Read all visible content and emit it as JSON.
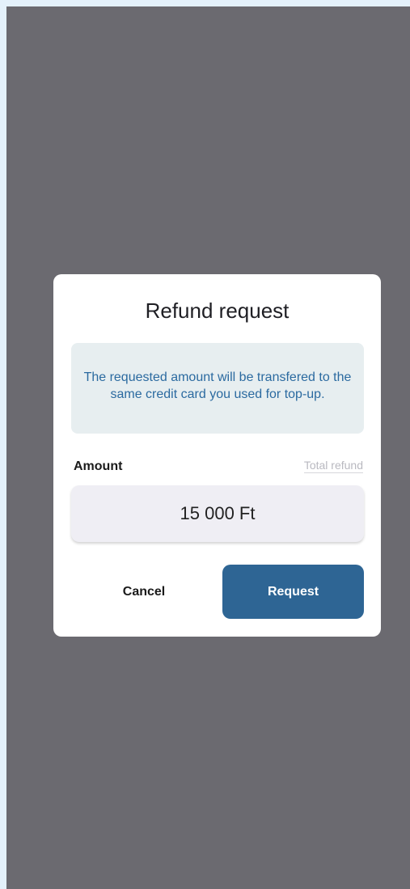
{
  "dialog": {
    "title": "Refund request",
    "info_text": "The requested amount will be transfered to the same credit card you used for top-up.",
    "amount_label": "Amount",
    "total_refund_label": "Total refund",
    "amount_value": "15 000 Ft",
    "cancel_label": "Cancel",
    "request_label": "Request"
  },
  "colors": {
    "overlay": "#6b6a70",
    "primary_button": "#2e6594",
    "info_text": "#2b6aa0",
    "info_background": "#e7eef0"
  }
}
